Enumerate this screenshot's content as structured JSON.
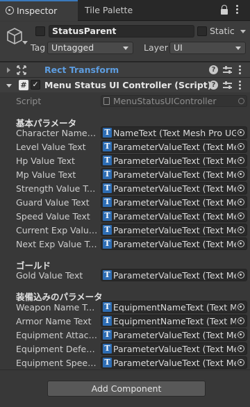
{
  "tabs": [
    {
      "label": "Inspector",
      "active": true
    },
    {
      "label": "Tile Palette",
      "active": false
    }
  ],
  "gameobject": {
    "name": "StatusParent",
    "static_label": "Static",
    "tag_label": "Tag",
    "tag_value": "Untagged",
    "layer_label": "Layer",
    "layer_value": "UI"
  },
  "components": {
    "rect_transform": {
      "title": "Rect Transform"
    },
    "controller": {
      "title": "Menu Status UI Controller (Script)",
      "script_label": "Script",
      "script_value": "MenuStatusUIController",
      "sections": [
        {
          "header": "基本パラメータ",
          "fields": [
            {
              "label": "Character Name T...",
              "value": "NameText (Text Mesh Pro UGUI)"
            },
            {
              "label": "Level Value Text",
              "value": "ParameterValueText (Text Mesh Pro UGUI)"
            },
            {
              "label": "Hp Value Text",
              "value": "ParameterValueText (Text Mesh Pro UGUI)"
            },
            {
              "label": "Mp Value Text",
              "value": "ParameterValueText (Text Mesh Pro UGUI)"
            },
            {
              "label": "Strength Value Text",
              "value": "ParameterValueText (Text Mesh Pro UGUI)"
            },
            {
              "label": "Guard Value Text",
              "value": "ParameterValueText (Text Mesh Pro UGUI)"
            },
            {
              "label": "Speed Value Text",
              "value": "ParameterValueText (Text Mesh Pro UGUI)"
            },
            {
              "label": "Current Exp Value ...",
              "value": "ParameterValueText (Text Mesh Pro UGUI)"
            },
            {
              "label": "Next Exp Value Text",
              "value": "ParameterValueText (Text Mesh Pro UGUI)"
            }
          ]
        },
        {
          "header": "ゴールド",
          "fields": [
            {
              "label": "Gold Value Text",
              "value": "ParameterValueText (Text Mesh Pro UGUI)"
            }
          ]
        },
        {
          "header": "装備込みのパラメータ",
          "fields": [
            {
              "label": "Weapon Name Text",
              "value": "EquipmentNameText (Text Mesh Pro UGUI)"
            },
            {
              "label": "Armor Name Text",
              "value": "EquipmentNameText (Text Mesh Pro UGUI)"
            },
            {
              "label": "Equipment Attack ...",
              "value": "ParameterValueText (Text Mesh Pro UGUI)"
            },
            {
              "label": "Equipment Defens...",
              "value": "ParameterValueText (Text Mesh Pro UGUI)"
            },
            {
              "label": "Equipment Speed ...",
              "value": "ParameterValueText (Text Mesh Pro UGUI)"
            }
          ]
        }
      ]
    }
  },
  "add_component_label": "Add Component",
  "colors": {
    "accent": "#3a79bb",
    "rect_transform_title": "#5d9de0",
    "text_icon": "#2e6db3"
  },
  "icons": {
    "tab": "inspector-icon",
    "lock": "lock-icon",
    "menu": "kebab-menu-icon",
    "gameobject": "cube-icon",
    "rect": "rect-transform-icon",
    "script": "csharp-script-icon",
    "field_type": "text-mesh-pro-icon",
    "picker": "object-picker-icon"
  }
}
